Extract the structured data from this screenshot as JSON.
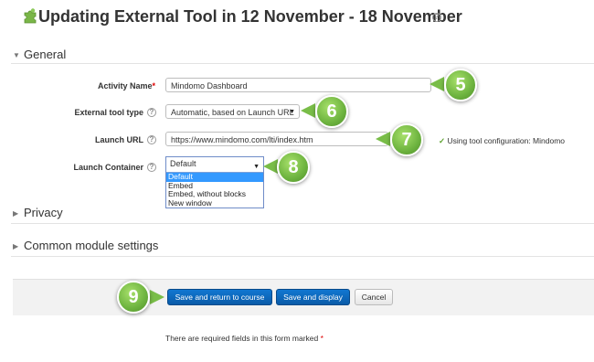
{
  "page": {
    "title": "Updating External Tool in 12 November - 18 November"
  },
  "sections": {
    "general": "General",
    "privacy": "Privacy",
    "common": "Common module settings"
  },
  "form": {
    "activity_name": {
      "label": "Activity Name",
      "required_mark": "*",
      "value": "Mindomo Dashboard"
    },
    "tool_type": {
      "label": "External tool type",
      "value": "Automatic, based on Launch URL"
    },
    "launch_url": {
      "label": "Launch URL",
      "value": "https://www.mindomo.com/lti/index.htm",
      "note_check": "✓",
      "note": "Using tool configuration: Mindomo"
    },
    "launch_container": {
      "label": "Launch Container",
      "value": "Default",
      "options": [
        "Default",
        "Embed",
        "Embed, without blocks",
        "New window"
      ]
    }
  },
  "badges": [
    "5",
    "6",
    "7",
    "8",
    "9"
  ],
  "buttons": {
    "save_return": "Save and return to course",
    "save_display": "Save and display",
    "cancel": "Cancel"
  },
  "footer": {
    "required_text": "There are required fields in this form marked",
    "required_mark": "*"
  },
  "icons": {
    "title": "puzzle-icon",
    "help": "help-icon"
  },
  "colors": {
    "accent": "#0a5ba8",
    "badge": "#6db33f",
    "dropdown_highlight": "#3399ff",
    "required": "#dd0000"
  }
}
